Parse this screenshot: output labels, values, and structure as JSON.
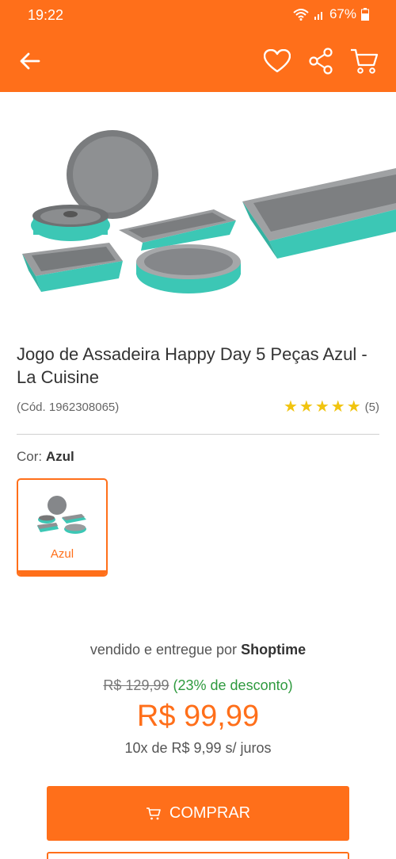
{
  "status_bar": {
    "time": "19:22",
    "battery": "67%"
  },
  "app_bar": {
    "back_icon": "arrow-left-icon",
    "favorite_icon": "heart-icon",
    "share_icon": "share-icon",
    "cart_icon": "cart-icon",
    "bg_color": "#ff6f1a"
  },
  "product": {
    "title": "Jogo de Assadeira Happy Day 5 Peças Azul - La Cuisine",
    "code": "(Cód. 1962308065)",
    "rating": {
      "stars": 5,
      "max": 5,
      "count_label": "(5)"
    }
  },
  "variant": {
    "label": "Cor:",
    "selected": "Azul",
    "options": [
      {
        "label": "Azul"
      }
    ]
  },
  "seller": {
    "prefix": "vendido e entregue por",
    "name": "Shoptime"
  },
  "pricing": {
    "old_price": "R$ 129,99",
    "discount": "(23% de desconto)",
    "price": "R$ 99,99",
    "installments": "10x de R$ 9,99 s/ juros"
  },
  "actions": {
    "buy_label": "COMPRAR"
  },
  "colors": {
    "accent": "#ff6f1a",
    "discount": "#2e9a3e",
    "star": "#f1c40f",
    "teal": "#3cc7b5"
  }
}
